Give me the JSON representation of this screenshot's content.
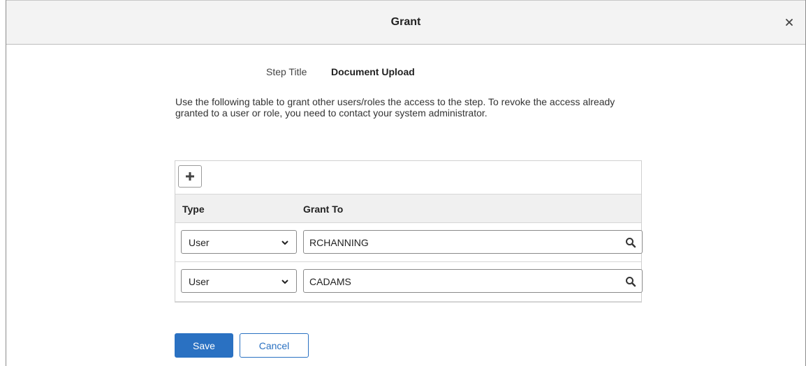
{
  "dialog": {
    "title": "Grant",
    "close_icon": "close-icon"
  },
  "step": {
    "label": "Step Title",
    "value": "Document Upload"
  },
  "instructions": "Use the following table to grant other users/roles the access to the step. To revoke the access already granted to a user or role, you need to contact your system administrator.",
  "grid": {
    "add_icon": "plus-icon",
    "columns": [
      "Type",
      "Grant To"
    ],
    "rows": [
      {
        "type": "User",
        "grant_to": "RCHANNING"
      },
      {
        "type": "User",
        "grant_to": "CADAMS"
      }
    ]
  },
  "actions": {
    "save_label": "Save",
    "cancel_label": "Cancel"
  },
  "colors": {
    "primary": "#2a71c2",
    "header_bg": "#f3f3f3",
    "grid_header_bg": "#f0f0f0"
  }
}
